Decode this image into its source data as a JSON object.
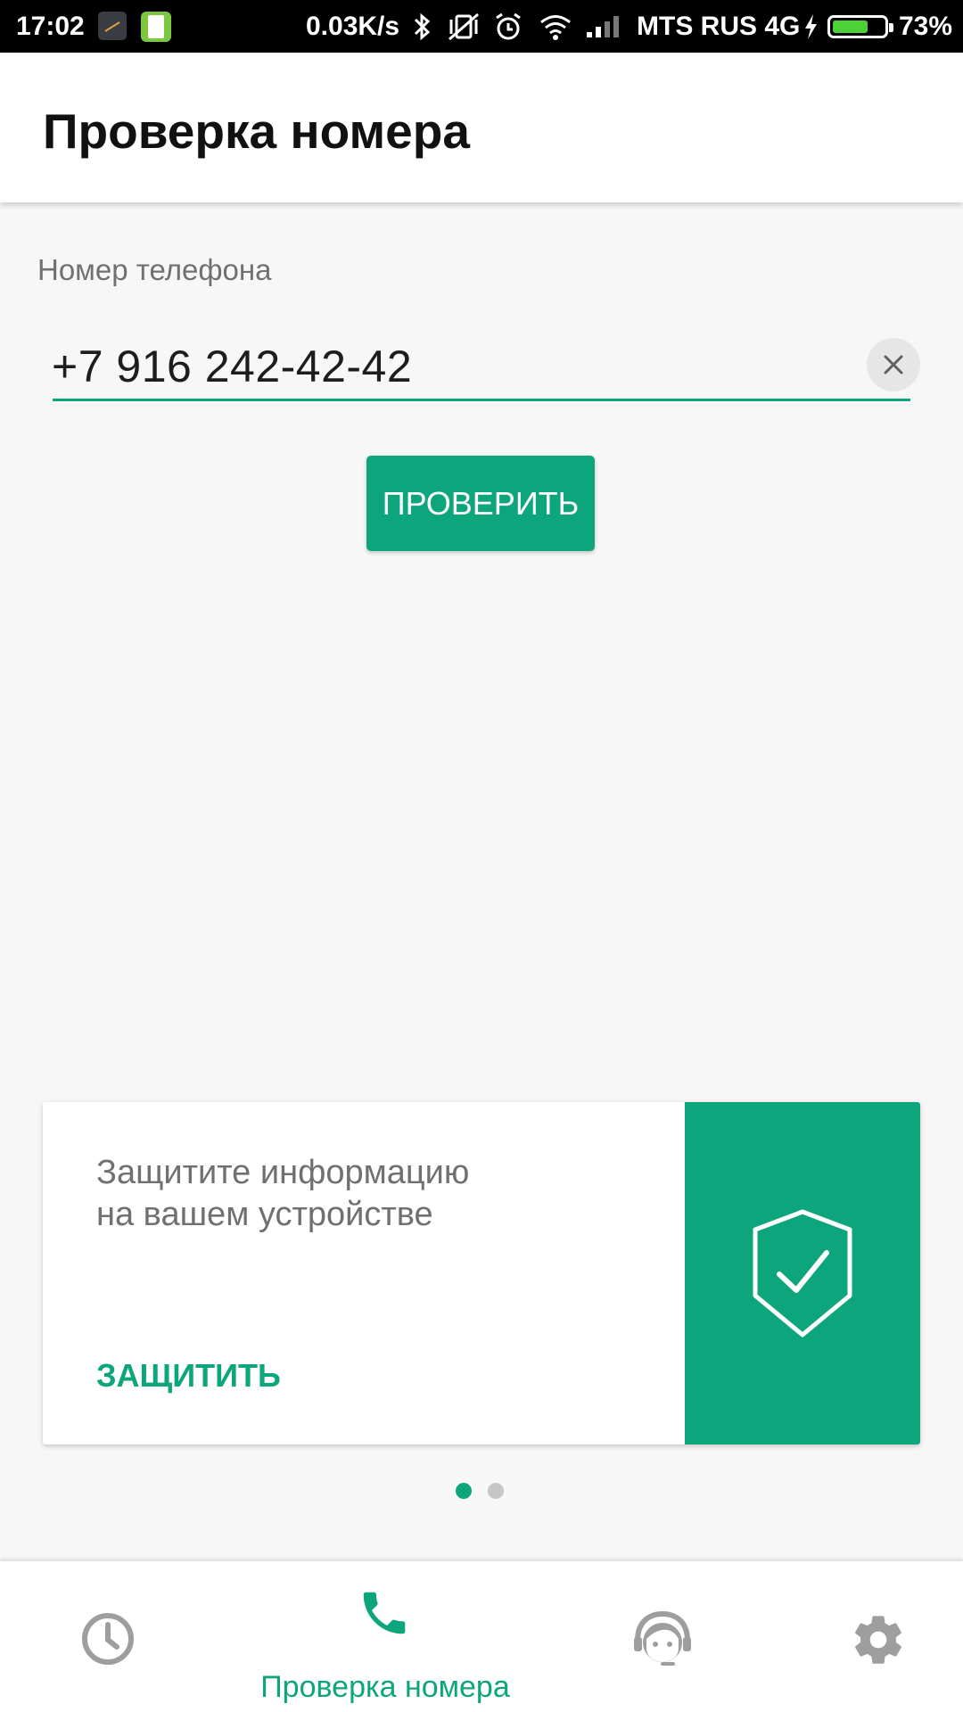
{
  "status_bar": {
    "time": "17:02",
    "network_speed": "0.03K/s",
    "carrier": "MTS RUS 4G",
    "battery_percent": "73%",
    "battery_level": 0.73,
    "icons": [
      "app-icon",
      "sim-app-icon",
      "bluetooth-icon",
      "vibrate-off-icon",
      "alarm-icon",
      "wifi-icon",
      "signal-icon",
      "charging-icon",
      "battery-icon"
    ]
  },
  "app_bar": {
    "title": "Проверка номера"
  },
  "phone_field": {
    "label": "Номер телефона",
    "value": "+7 916 242-42-42",
    "clear_icon": "close-icon"
  },
  "check_button": {
    "label": "ПРОВЕРИТЬ"
  },
  "promo_card": {
    "line1": "Защитите информацию",
    "line2": "на вашем устройстве",
    "action_label": "ЗАЩИТИТЬ",
    "icon": "shield-check-icon"
  },
  "pager": {
    "count": 2,
    "active_index": 0
  },
  "bottom_nav": {
    "items": [
      {
        "icon": "clock-icon",
        "label": "",
        "active": false
      },
      {
        "icon": "phone-icon",
        "label": "Проверка номера",
        "active": true
      },
      {
        "icon": "support-agent-icon",
        "label": "",
        "active": false
      },
      {
        "icon": "gear-icon",
        "label": "",
        "active": false
      }
    ]
  },
  "colors": {
    "accent": "#0da67c",
    "status_bar": "#000000",
    "background": "#f7f7f7",
    "inactive_icon": "#9e9e9e",
    "secondary_text": "#707070"
  }
}
